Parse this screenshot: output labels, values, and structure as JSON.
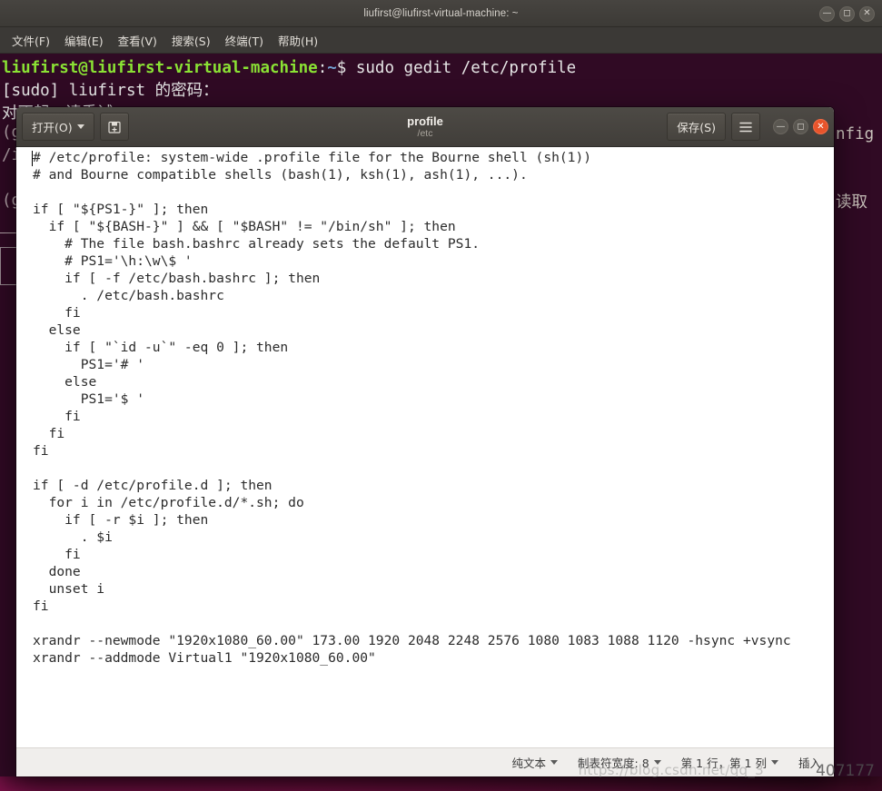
{
  "desktop": {
    "background_color": "#300a22",
    "accent_color": "#7e1248"
  },
  "terminal": {
    "title": "liufirst@liufirst-virtual-machine: ~",
    "background_color": "#300a24",
    "prompt_color": "#8ae234",
    "menu": [
      {
        "name": "file",
        "label": "文件(F)"
      },
      {
        "name": "edit",
        "label": "编辑(E)"
      },
      {
        "name": "view",
        "label": "查看(V)"
      },
      {
        "name": "search",
        "label": "搜索(S)"
      },
      {
        "name": "terminal",
        "label": "终端(T)"
      },
      {
        "name": "help",
        "label": "帮助(H)"
      }
    ],
    "window_buttons": [
      {
        "name": "minimize",
        "glyph": "—"
      },
      {
        "name": "maximize",
        "glyph": "◻"
      },
      {
        "name": "close",
        "glyph": "✕"
      }
    ],
    "lines": [
      {
        "user": "liufirst@liufirst-virtual-machine",
        "sep": ":",
        "path": "~",
        "dollar": "$ ",
        "command": "sudo gedit /etc/profile"
      },
      {
        "text": "[sudo] liufirst 的密码："
      },
      {
        "text": "对不起，请重试。"
      }
    ],
    "occluded_left_fragments": [
      "(g",
      "/i",
      "(g"
    ],
    "occluded_right_fragments": [
      "nfig",
      "读取"
    ]
  },
  "gedit": {
    "title": "profile",
    "subtitle": "/etc",
    "open_button": "打开(O)",
    "saveas_icon": "save-as-icon",
    "save_button": "保存(S)",
    "menu_icon": "hamburger-menu-icon",
    "window_buttons": [
      {
        "name": "minimize",
        "glyph": "—"
      },
      {
        "name": "maximize",
        "glyph": "◻"
      },
      {
        "name": "close",
        "glyph": "✕"
      }
    ],
    "document_text": "# /etc/profile: system-wide .profile file for the Bourne shell (sh(1))\n# and Bourne compatible shells (bash(1), ksh(1), ash(1), ...).\n\nif [ \"${PS1-}\" ]; then\n  if [ \"${BASH-}\" ] && [ \"$BASH\" != \"/bin/sh\" ]; then\n    # The file bash.bashrc already sets the default PS1.\n    # PS1='\\h:\\w\\$ '\n    if [ -f /etc/bash.bashrc ]; then\n      . /etc/bash.bashrc\n    fi\n  else\n    if [ \"`id -u`\" -eq 0 ]; then\n      PS1='# '\n    else\n      PS1='$ '\n    fi\n  fi\nfi\n\nif [ -d /etc/profile.d ]; then\n  for i in /etc/profile.d/*.sh; do\n    if [ -r $i ]; then\n      . $i\n    fi\n  done\n  unset i\nfi\n\nxrandr --newmode \"1920x1080_60.00\" 173.00 1920 2048 2248 2576 1080 1083 1088 1120 -hsync +vsync\nxrandr --addmode Virtual1 \"1920x1080_60.00\"",
    "statusbar": {
      "language": "纯文本",
      "tab_width": "制表符宽度: 8",
      "position": "第 1 行，第 1 列",
      "insert_mode": "插入"
    }
  },
  "watermark": {
    "url": "https://blog.csdn.net/qq_3",
    "number": "407177"
  }
}
